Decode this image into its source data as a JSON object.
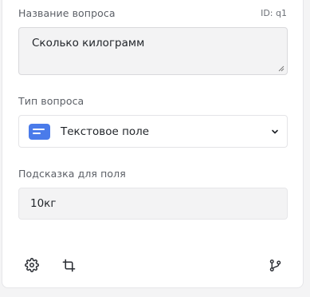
{
  "question": {
    "title_label": "Название вопроса",
    "id_text": "ID: q1",
    "title_value": "Сколько килограмм"
  },
  "type": {
    "label": "Тип вопроса",
    "selected": "Текстовое поле",
    "icon": "text-field-icon",
    "icon_color": "#4a7bea"
  },
  "hint": {
    "label": "Подсказка для поля",
    "value": "10кг"
  },
  "toolbar": {
    "icons": [
      "settings-gear-icon",
      "crop-icon",
      "branch-icon"
    ]
  }
}
